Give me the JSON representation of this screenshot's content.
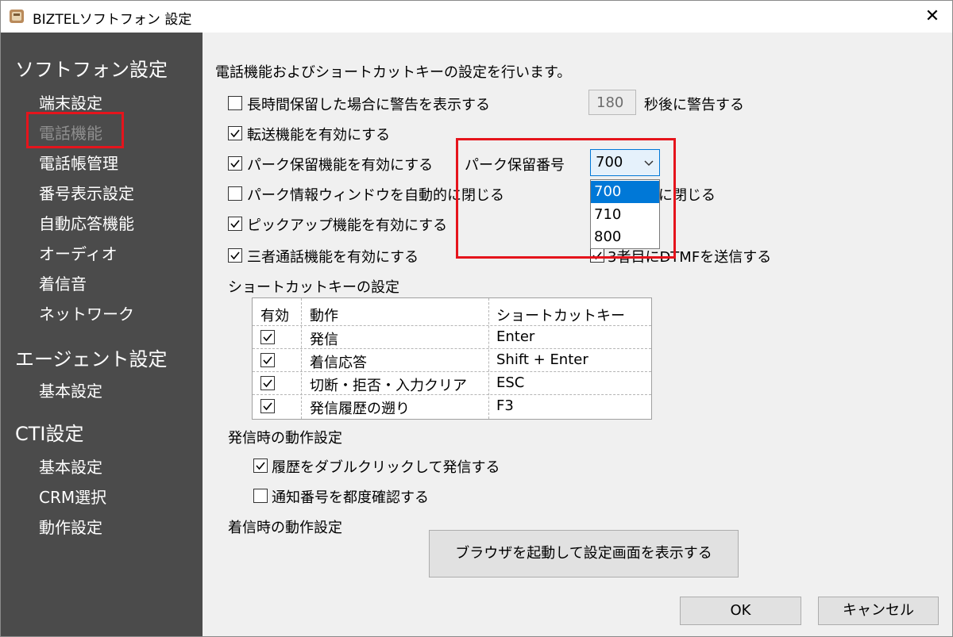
{
  "window": {
    "title": "BIZTELソフトフォン 設定",
    "close_glyph": "✕"
  },
  "sidebar": {
    "sections": [
      {
        "label": "ソフトフォン設定",
        "items": [
          "端末設定",
          "電話機能",
          "電話帳管理",
          "番号表示設定",
          "自動応答機能",
          "オーディオ",
          "着信音",
          "ネットワーク"
        ]
      },
      {
        "label": "エージェント設定",
        "items": [
          "基本設定"
        ]
      },
      {
        "label": "CTI設定",
        "items": [
          "基本設定",
          "CRM選択",
          "動作設定"
        ]
      }
    ],
    "active_item": "電話機能",
    "highlight_color": "#e5141c"
  },
  "content": {
    "description": "電話機能およびショートカットキーの設定を行います。",
    "options": {
      "long_hold": {
        "label": "長時間保留した場合に警告を表示する",
        "checked": false,
        "seconds": "180",
        "suffix": "秒後に警告する"
      },
      "transfer": {
        "label": "転送機能を有効にする",
        "checked": true
      },
      "park_hold": {
        "label": "パーク保留機能を有効にする",
        "checked": true,
        "number_label": "パーク保留番号",
        "selected": "700",
        "dropdown_options": [
          "700",
          "710",
          "800"
        ]
      },
      "park_info": {
        "label": "パーク情報ウィンドウを自動的に閉じる",
        "checked": false,
        "suffix": "後に閉じる"
      },
      "pickup": {
        "label": "ピックアップ機能を有効にする",
        "checked": true
      },
      "three_way": {
        "label": "三者通話機能を有効にする",
        "checked": true,
        "dtmf_label": "3者目にDTMFを送信する",
        "dtmf_checked": true
      }
    },
    "shortcut": {
      "heading": "ショートカットキーの設定",
      "columns": [
        "有効",
        "動作",
        "ショートカットキー"
      ],
      "rows": [
        {
          "enabled": true,
          "action": "発信",
          "key": "Enter"
        },
        {
          "enabled": true,
          "action": "着信応答",
          "key": "Shift + Enter"
        },
        {
          "enabled": true,
          "action": "切断・拒否・入力クリア",
          "key": "ESC"
        },
        {
          "enabled": true,
          "action": "発信履歴の遡り",
          "key": "F3"
        }
      ]
    },
    "outgoing": {
      "heading": "発信時の動作設定",
      "history_dblclick": {
        "label": "履歴をダブルクリックして発信する",
        "checked": true
      },
      "confirm_number": {
        "label": "通知番号を都度確認する",
        "checked": false
      }
    },
    "incoming": {
      "heading": "着信時の動作設定",
      "browser_button": "ブラウザを起動して設定画面を表示する"
    }
  },
  "footer": {
    "ok": "OK",
    "cancel": "キャンセル"
  }
}
